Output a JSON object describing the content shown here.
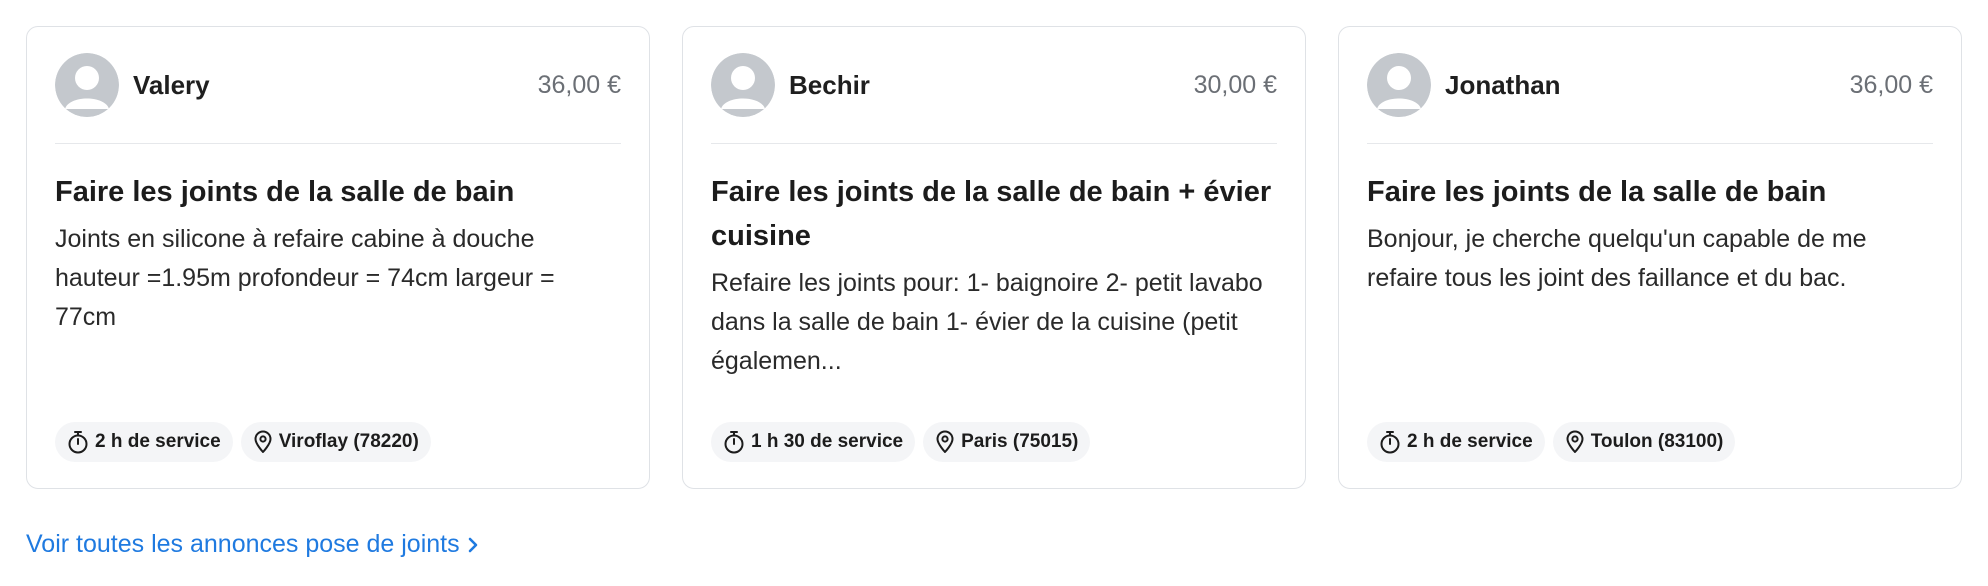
{
  "cards": [
    {
      "name": "Valery",
      "price": "36,00 €",
      "title": "Faire les joints de la salle de bain",
      "description": "Joints en silicone à refaire cabine à douche hauteur =1.95m profondeur = 74cm largeur = 77cm",
      "duration": "2 h de service",
      "location": "Viroflay (78220)"
    },
    {
      "name": "Bechir",
      "price": "30,00 €",
      "title": "Faire les joints de la salle de bain + évier cuisine",
      "description": "Refaire les joints pour: 1- baignoire 2- petit lavabo dans la salle de bain 1- évier de la cuisine (petit égalemen...",
      "duration": "1 h 30 de service",
      "location": "Paris (75015)"
    },
    {
      "name": "Jonathan",
      "price": "36,00 €",
      "title": "Faire les joints de la salle de bain",
      "description": "Bonjour, je cherche quelqu'un capable de me refaire tous les joint des faillance et du bac.",
      "duration": "2 h de service",
      "location": "Toulon (83100)"
    }
  ],
  "footer_link": {
    "label": "Voir toutes les annonces pose de joints"
  },
  "icons": {
    "avatar": "default-user-avatar-icon",
    "duration": "stopwatch-icon",
    "location": "map-pin-icon",
    "link": "chevron-right-icon"
  },
  "colors": {
    "link": "#1f7ae0",
    "border": "#dfe2e6",
    "tag_background": "#f4f5f7",
    "price": "#6b6f75",
    "avatar": "#c4c8cd"
  }
}
